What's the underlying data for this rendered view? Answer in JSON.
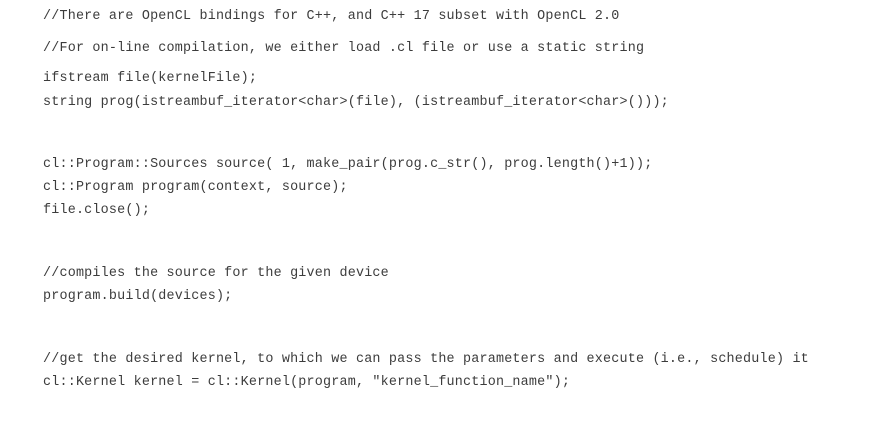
{
  "code": {
    "lines": [
      "//There are OpenCL bindings for C++, and C++ 17 subset with OpenCL 2.0",
      "//For on-line compilation, we either load .cl file or use a static string",
      "ifstream file(kernelFile);",
      "string prog(istreambuf_iterator<char>(file), (istreambuf_iterator<char>()));",
      "cl::Program::Sources source( 1, make_pair(prog.c_str(), prog.length()+1));",
      "cl::Program program(context, source);",
      "file.close();",
      "//compiles the source for the given device",
      "program.build(devices);",
      "//get the desired kernel, to which we can pass the parameters and execute (i.e., schedule) it",
      "cl::Kernel kernel = cl::Kernel(program, \"kernel_function_name\");"
    ]
  }
}
